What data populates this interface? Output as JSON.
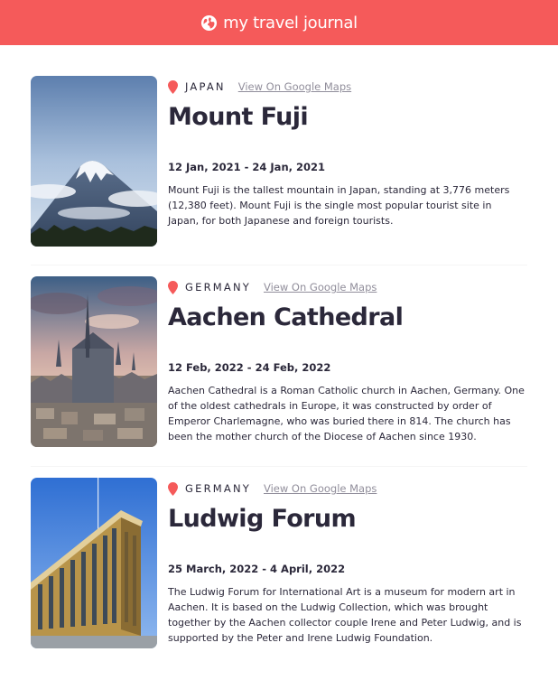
{
  "header": {
    "title": "my travel journal",
    "icon": "globe-icon",
    "background": "#F55A5A"
  },
  "entries": [
    {
      "country": "JAPAN",
      "maps_link": "View On Google Maps",
      "title": "Mount Fuji",
      "dates": "12 Jan, 2021 - 24 Jan, 2021",
      "description": "Mount Fuji is the tallest mountain in Japan, standing at 3,776 meters (12,380 feet). Mount Fuji is the single most popular tourist site in Japan, for both Japanese and foreign tourists."
    },
    {
      "country": "GERMANY",
      "maps_link": "View On Google Maps",
      "title": "Aachen Cathedral",
      "dates": "12 Feb, 2022 - 24 Feb, 2022",
      "description": "Aachen Cathedral is a Roman Catholic church in Aachen, Germany. One of the oldest cathedrals in Europe, it was constructed by order of Emperor Charlemagne, who was buried there in 814. The church has been the mother church of the Diocese of Aachen since 1930."
    },
    {
      "country": "GERMANY",
      "maps_link": "View On Google Maps",
      "title": "Ludwig Forum",
      "dates": "25 March, 2022 - 4 April, 2022",
      "description": "The Ludwig Forum for International Art is a museum for modern art in Aachen. It is based on the Ludwig Collection, which was brought together by the Aachen collector couple Irene and Peter Ludwig, and is supported by the Peter and Irene Ludwig Foundation."
    }
  ],
  "colors": {
    "accent": "#F55A5A",
    "text": "#2B283A",
    "muted": "#918E9B"
  }
}
